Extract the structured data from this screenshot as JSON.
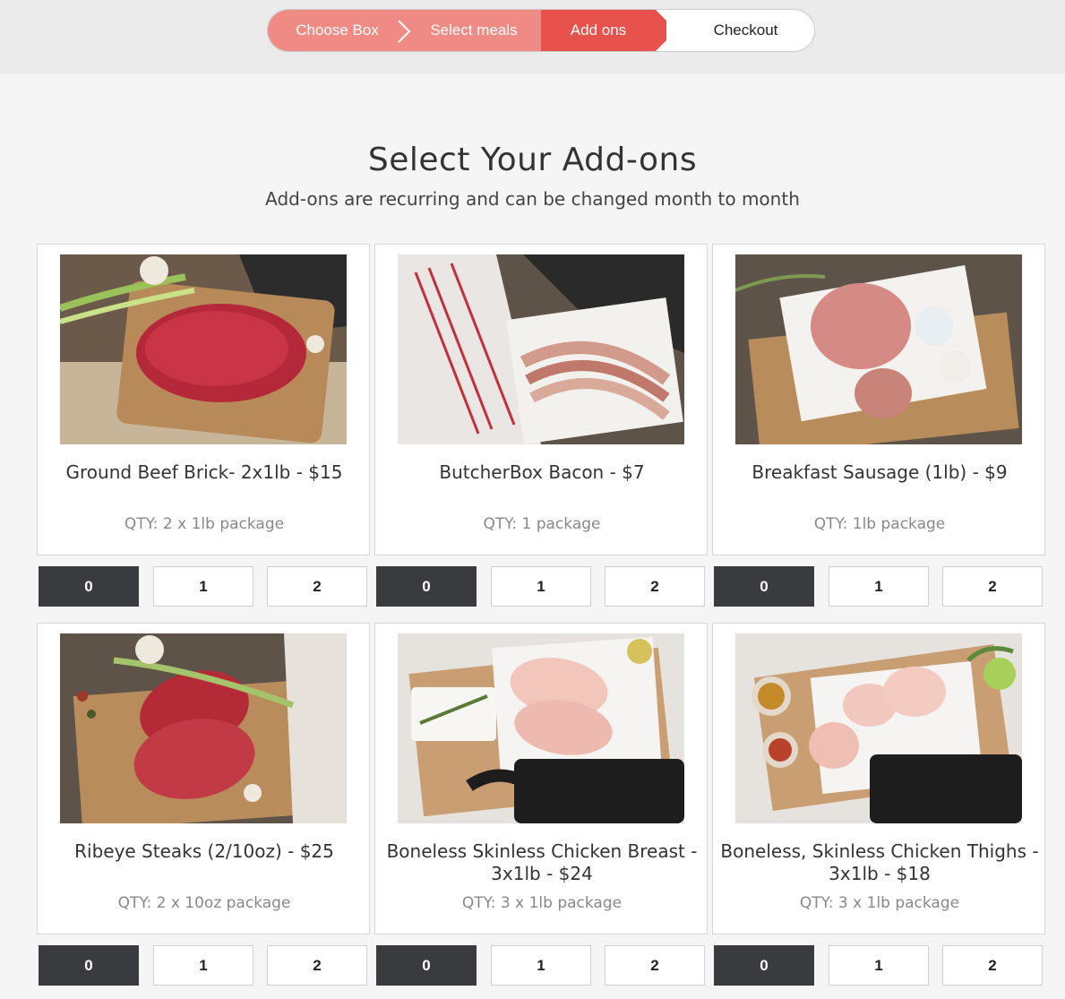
{
  "steps": {
    "choose_box": "Choose Box",
    "select_meals": "Select meals",
    "add_ons": "Add ons",
    "checkout": "Checkout"
  },
  "heading": {
    "title": "Select Your Add-ons",
    "subtitle": "Add-ons are recurring and can be changed month to month"
  },
  "products": [
    {
      "name": "Ground Beef Brick- 2x1lb - $15",
      "qty": "QTY: 2 x 1lb package",
      "image": "ground-beef-image"
    },
    {
      "name": "ButcherBox Bacon - $7",
      "qty": "QTY: 1 package",
      "image": "bacon-image"
    },
    {
      "name": "Breakfast Sausage (1lb) - $9",
      "qty": "QTY: 1lb package",
      "image": "sausage-image"
    },
    {
      "name": "Ribeye Steaks (2/10oz) - $25",
      "qty": "QTY: 2 x 10oz package",
      "image": "ribeye-image"
    },
    {
      "name": "Boneless Skinless Chicken Breast - 3x1lb - $24",
      "qty": "QTY: 3 x 1lb package",
      "image": "chicken-breast-image"
    },
    {
      "name": "Boneless, Skinless Chicken Thighs - 3x1lb - $18",
      "qty": "QTY: 3 x 1lb package",
      "image": "chicken-thighs-image"
    }
  ],
  "quantity_options": [
    "0",
    "1",
    "2"
  ],
  "selected_quantity": "0",
  "colors": {
    "step_done": "#ef8a84",
    "step_active": "#e8524d",
    "selected_button": "#3a3b3e"
  }
}
